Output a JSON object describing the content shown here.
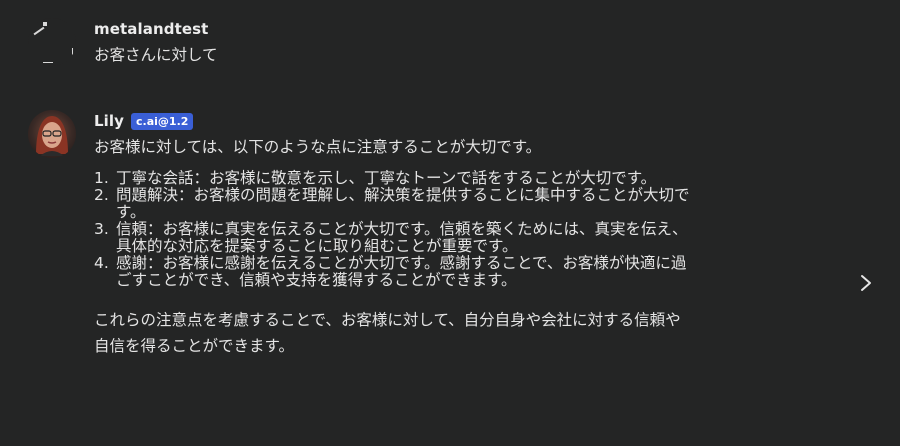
{
  "messages": {
    "user": {
      "name": "metalandtest",
      "text": "お客さんに対して"
    },
    "bot": {
      "name": "Lily",
      "badge": "c.ai@1.2",
      "intro": "お客様に対しては、以下のような点に注意することが大切です。",
      "points": [
        {
          "num": "1.",
          "text": "丁寧な会話：お客様に敬意を示し、丁寧なトーンで話をすることが大切です。"
        },
        {
          "num": "2.",
          "text": "問題解決：お客様の問題を理解し、解決策を提供することに集中することが大切です。"
        },
        {
          "num": "3.",
          "text": "信頼：お客様に真実を伝えることが大切です。信頼を築くためには、真実を伝え、具体的な対応を提案することに取り組むことが重要です。"
        },
        {
          "num": "4.",
          "text": "感謝：お客様に感謝を伝えることが大切です。感謝することで、お客様が快適に過ごすことができ、信頼や支持を獲得することができます。"
        }
      ],
      "closing": "これらの注意点を考慮することで、お客様に対して、自分自身や会社に対する信頼や自信を得ることができます。"
    }
  },
  "icons": {
    "next": "chevron-right-icon"
  },
  "colors": {
    "background": "#242525",
    "badge": "#3a5fd6"
  }
}
